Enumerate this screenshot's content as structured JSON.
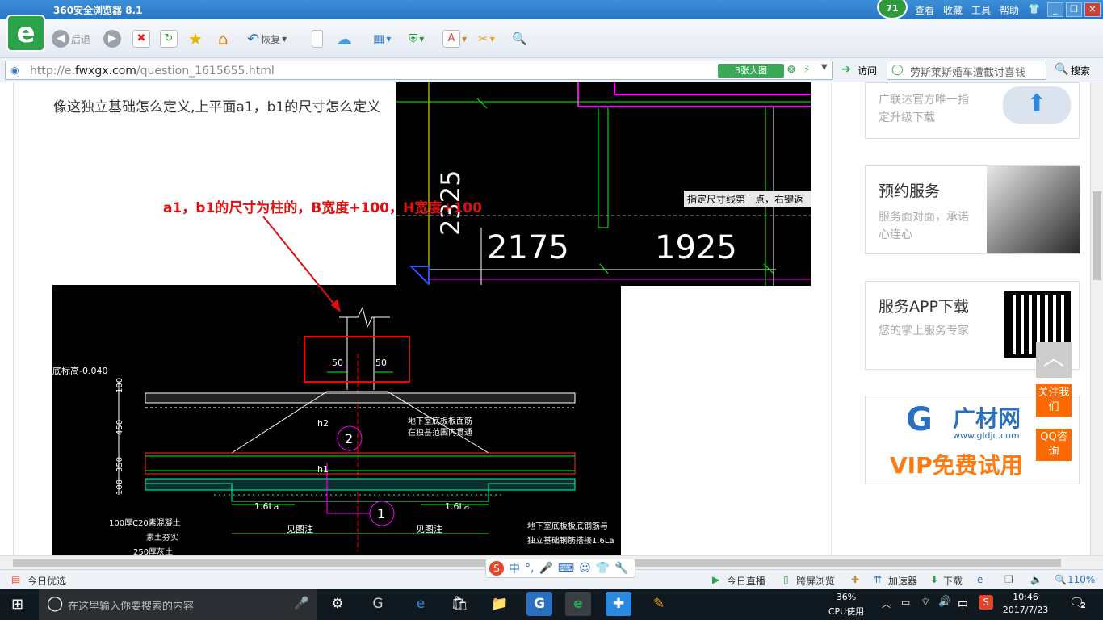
{
  "browser": {
    "title": "360安全浏览器 8.1",
    "badge": "71",
    "menus": [
      "查看",
      "收藏",
      "工具",
      "帮助"
    ],
    "back_label": "后退",
    "restore_label": "恢复",
    "url_prefix": "http://e.",
    "url_domain": "fwxgx.com",
    "url_path": "/question_1615655.html",
    "bigpic_label": "3张大图",
    "visit_label": "访问",
    "search_value": "劳斯莱斯婚车遭截讨喜钱",
    "search_button": "搜索"
  },
  "page": {
    "question": "像这独立基础怎么定义,上平面a1，b1的尺寸怎么定义",
    "annotation": "a1，b1的尺寸为柱的，B宽度+100，H宽度+100",
    "cad_top": {
      "dim_vertical": "2325",
      "dim_left": "2175",
      "dim_right": "1925",
      "prompt": "指定尺寸线第一点，右键返"
    },
    "cad_bottom": {
      "elev": "底标高-0.040",
      "left_dims": [
        "100",
        "450",
        "350",
        "100"
      ],
      "dim50a": "50",
      "dim50b": "50",
      "h2": "h2",
      "h1": "h1",
      "circle2": "2",
      "circle1": "1",
      "label_top": "地下室底板板面筋",
      "label_top2": "在独基范围内贯通",
      "la_left": "1.6La",
      "la_right": "1.6La",
      "see_left": "见图注",
      "see_right": "见图注",
      "left_note1": "100厚C20素混凝土",
      "left_note2": "素土夯实",
      "left_note3": "250厚灰土",
      "right_note1": "地下室底板板底钢筋与",
      "right_note2": "独立基础钢筋搭接1.6La"
    }
  },
  "sidebar": {
    "cards": [
      {
        "title": "",
        "sub": "广联达官方唯一指定升级下载"
      },
      {
        "title": "预约服务",
        "sub": "服务面对面，承诺心连心"
      },
      {
        "title": "服务APP下载",
        "sub": "您的掌上服务专家"
      }
    ],
    "ad_brand": "广材网",
    "ad_url": "www.gldjc.com",
    "ad_vip": "VIP免费试用",
    "follow": "关注我们",
    "qq": "QQ咨询"
  },
  "statusbar": {
    "left": "今日优选",
    "live": "今日直播",
    "screen": "跨屏浏览",
    "accel": "加速器",
    "download": "下载",
    "zoom": "110%"
  },
  "taskbar": {
    "search_placeholder": "在这里输入你要搜索的内容",
    "cpu": "36%",
    "cpu_label": "CPU使用",
    "ime": "中",
    "time": "10:46",
    "date": "2017/7/23",
    "notif": "2"
  },
  "colors": {
    "accent": "#2a74c2",
    "annotation": "#e01010",
    "orange": "#ff6a00"
  }
}
